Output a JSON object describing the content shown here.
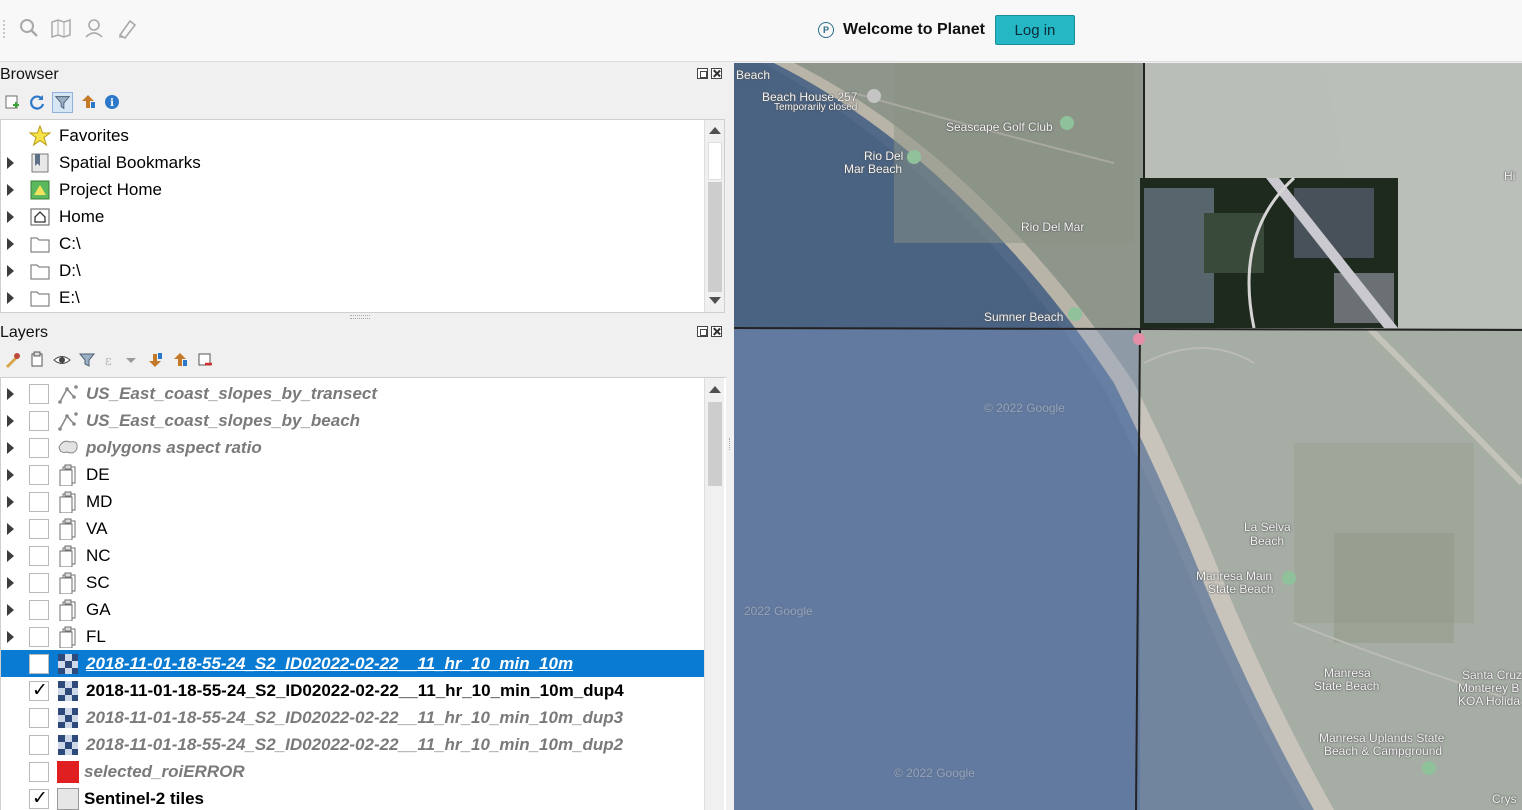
{
  "toolbar": {
    "icons": [
      "identify-icon",
      "map-tips-icon",
      "user-location-icon",
      "digitize-icon"
    ],
    "planet_logo": "P",
    "planet_welcome": "Welcome to Planet",
    "login_label": "Log in",
    "login_color": "#25b7c4"
  },
  "browser": {
    "title": "Browser",
    "items": [
      {
        "label": "Favorites",
        "icon": "star-icon"
      },
      {
        "label": "Spatial Bookmarks",
        "icon": "bookmark-icon"
      },
      {
        "label": "Project Home",
        "icon": "project-home-icon"
      },
      {
        "label": "Home",
        "icon": "home-icon"
      },
      {
        "label": "C:\\",
        "icon": "folder-icon"
      },
      {
        "label": "D:\\",
        "icon": "folder-icon"
      },
      {
        "label": "E:\\",
        "icon": "folder-icon"
      }
    ]
  },
  "layers": {
    "title": "Layers",
    "items": [
      {
        "label": "US_East_coast_slopes_by_transect",
        "checked": false,
        "style": "dim",
        "icon": "line-layer-icon"
      },
      {
        "label": "US_East_coast_slopes_by_beach",
        "checked": false,
        "style": "dim",
        "icon": "line-layer-icon"
      },
      {
        "label": "polygons aspect ratio",
        "checked": false,
        "style": "dim",
        "icon": "polygon-layer-icon"
      },
      {
        "label": "DE",
        "checked": false,
        "style": "normal",
        "icon": "group-layer-icon"
      },
      {
        "label": "MD",
        "checked": false,
        "style": "normal",
        "icon": "group-layer-icon"
      },
      {
        "label": "VA",
        "checked": false,
        "style": "normal",
        "icon": "group-layer-icon"
      },
      {
        "label": "NC",
        "checked": false,
        "style": "normal",
        "icon": "group-layer-icon"
      },
      {
        "label": "SC",
        "checked": false,
        "style": "normal",
        "icon": "group-layer-icon"
      },
      {
        "label": "GA",
        "checked": false,
        "style": "normal",
        "icon": "group-layer-icon"
      },
      {
        "label": "FL",
        "checked": false,
        "style": "normal",
        "icon": "group-layer-icon"
      },
      {
        "label": "2018-11-01-18-55-24_S2_ID02022-02-22__11_hr_10_min_10m",
        "checked": false,
        "style": "selected",
        "icon": "raster-layer-icon"
      },
      {
        "label": "2018-11-01-18-55-24_S2_ID02022-02-22__11_hr_10_min_10m_dup4",
        "checked": true,
        "style": "bold",
        "icon": "raster-layer-icon"
      },
      {
        "label": "2018-11-01-18-55-24_S2_ID02022-02-22__11_hr_10_min_10m_dup3",
        "checked": false,
        "style": "dim",
        "icon": "raster-layer-icon"
      },
      {
        "label": "2018-11-01-18-55-24_S2_ID02022-02-22__11_hr_10_min_10m_dup2",
        "checked": false,
        "style": "dim",
        "icon": "raster-layer-icon"
      },
      {
        "label": "selected_roiERROR",
        "checked": false,
        "style": "dim",
        "icon": "red-fill-icon"
      },
      {
        "label": "Sentinel-2 tiles",
        "checked": true,
        "style": "bold",
        "icon": "grey-fill-icon"
      }
    ]
  },
  "map": {
    "labels": [
      "Beach",
      "Beach House 257",
      "Temporarily closed",
      "Seascape Golf Club",
      "Rio Del",
      "Mar Beach",
      "Rio Del Mar",
      "Sumner Beach",
      "La Selva",
      "Beach",
      "Manresa Main",
      "State Beach",
      "Manresa",
      "State Beach",
      "Manresa Uplands State",
      "Beach & Campground",
      "Santa Cruz",
      "Monterey B",
      "KOA Holida",
      "Hi",
      "© 2022 Google",
      "2022 Google",
      "© 2022 Google",
      "Crys"
    ]
  }
}
